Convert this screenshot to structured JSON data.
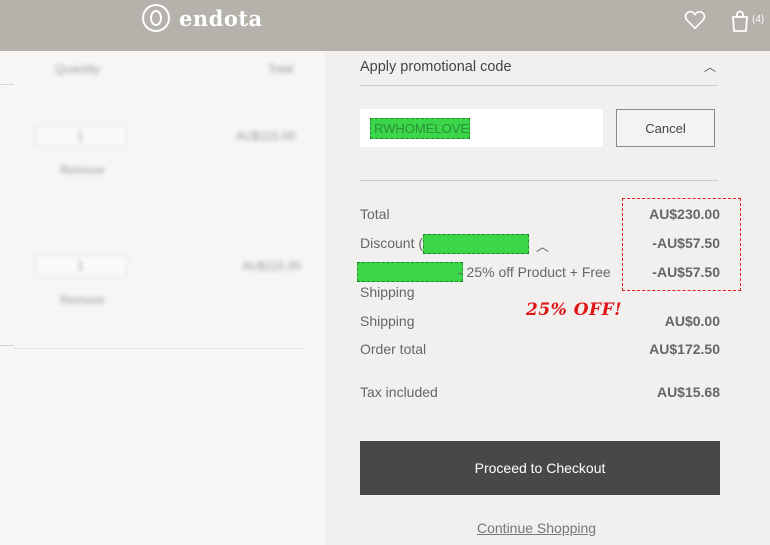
{
  "header": {
    "brand": "endota",
    "cart_count": "(4)"
  },
  "left_panel": {
    "columns": [
      "Quantity",
      "Total"
    ],
    "items": [
      {
        "qty": "1",
        "total": "AU$115.00",
        "remove": "Remove"
      },
      {
        "qty": "1",
        "total": "AU$115.00",
        "remove": "Remove"
      }
    ]
  },
  "promo": {
    "title": "Apply promotional code",
    "code_value": "RWHOMELOVE",
    "cancel_label": "Cancel"
  },
  "summary": {
    "total_label": "Total",
    "total_value": "AU$230.00",
    "discount_label": "Discount (",
    "discount_value": "-AU$57.50",
    "discount_desc": "- 25% off Product + Free",
    "discount_desc_value": "-AU$57.50",
    "shipping_wrap": "Shipping",
    "shipping_label": "Shipping",
    "shipping_value": "AU$0.00",
    "order_total_label": "Order total",
    "order_total_value": "AU$172.50",
    "tax_label": "Tax included",
    "tax_value": "AU$15.68"
  },
  "annotation": {
    "off_text": "25% OFF!"
  },
  "actions": {
    "checkout_label": "Proceed to Checkout",
    "continue_label": "Continue Shopping"
  },
  "colors": {
    "header": "#b5b1ab",
    "button": "#4a4847",
    "highlight": "#3cd64b",
    "annotation": "#e01515"
  }
}
